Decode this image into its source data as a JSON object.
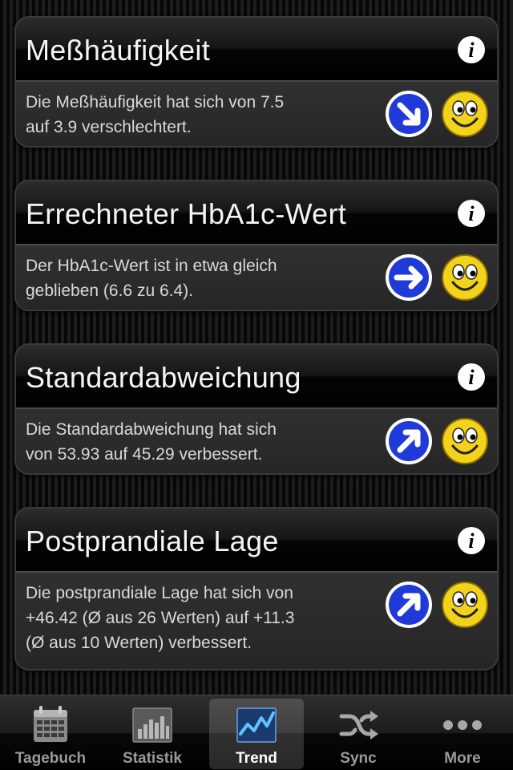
{
  "cards": [
    {
      "title": "Meßhäufigkeit",
      "text": "Die Meßhäufigkeit hat sich von 7.5\nauf 3.9 verschlechtert.",
      "trend": "arrow-down-right-icon",
      "mood": "smiley-icon"
    },
    {
      "title": "Errechneter HbA1c-Wert",
      "text": "Der HbA1c-Wert ist in etwa gleich\ngeblieben (6.6 zu 6.4).",
      "trend": "arrow-right-icon",
      "mood": "smiley-icon"
    },
    {
      "title": "Standardabweichung",
      "text": "Die Standardabweichung hat sich\nvon 53.93 auf 45.29 verbessert.",
      "trend": "arrow-up-right-icon",
      "mood": "smiley-icon"
    },
    {
      "title": "Postprandiale Lage",
      "text": "Die postprandiale Lage hat sich von\n+46.42  (Ø aus 26 Werten) auf +11.3\n(Ø aus 10 Werten) verbessert.",
      "trend": "arrow-up-right-icon",
      "mood": "smiley-icon"
    }
  ],
  "tabbar": {
    "active": "Trend",
    "tabs": [
      {
        "label": "Tagebuch",
        "icon": "calendar-icon"
      },
      {
        "label": "Statistik",
        "icon": "bar-chart-icon"
      },
      {
        "label": "Trend",
        "icon": "trend-line-icon"
      },
      {
        "label": "Sync",
        "icon": "shuffle-icon"
      },
      {
        "label": "More",
        "icon": "more-dots-icon"
      }
    ]
  },
  "colors": {
    "arrow_blue": "#1f3ad8",
    "smiley_yellow": "#f2d21a",
    "active_tab_text": "#ffffff",
    "inactive_tab_text": "#9a9a9a"
  }
}
